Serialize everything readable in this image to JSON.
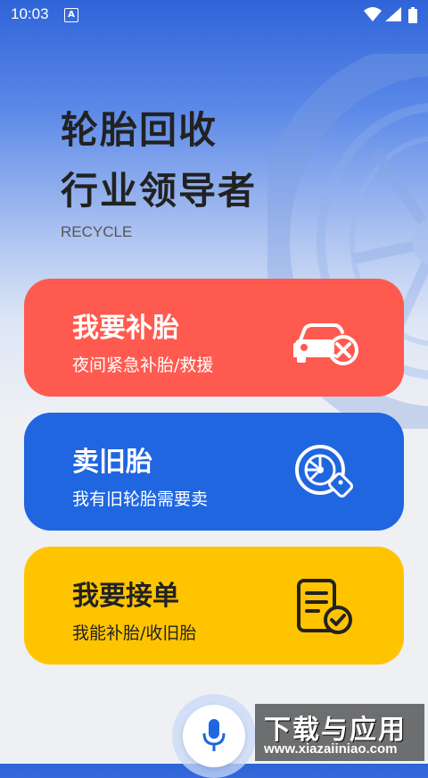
{
  "status_bar": {
    "time": "10:03",
    "notification_icon": "a-icon",
    "icons": [
      "wifi-icon",
      "signal-icon",
      "battery-icon"
    ]
  },
  "hero": {
    "title_line1": "轮胎回收",
    "title_line2": "行业领导者",
    "subtitle": "RECYCLE"
  },
  "cards": [
    {
      "title": "我要补胎",
      "subtitle": "夜间紧急补胎/救援",
      "icon": "car-repair-icon",
      "color": "#ff5a4f"
    },
    {
      "title": "卖旧胎",
      "subtitle": "我有旧轮胎需要卖",
      "icon": "tire-tag-icon",
      "color": "#1f66e0"
    },
    {
      "title": "我要接单",
      "subtitle": "我能补胎/收旧胎",
      "icon": "order-check-icon",
      "color": "#ffc400"
    }
  ],
  "mic": {
    "icon": "microphone-icon"
  },
  "watermark": {
    "line1": "下载与应用",
    "line2": "www.xiazaiiniao.com"
  }
}
